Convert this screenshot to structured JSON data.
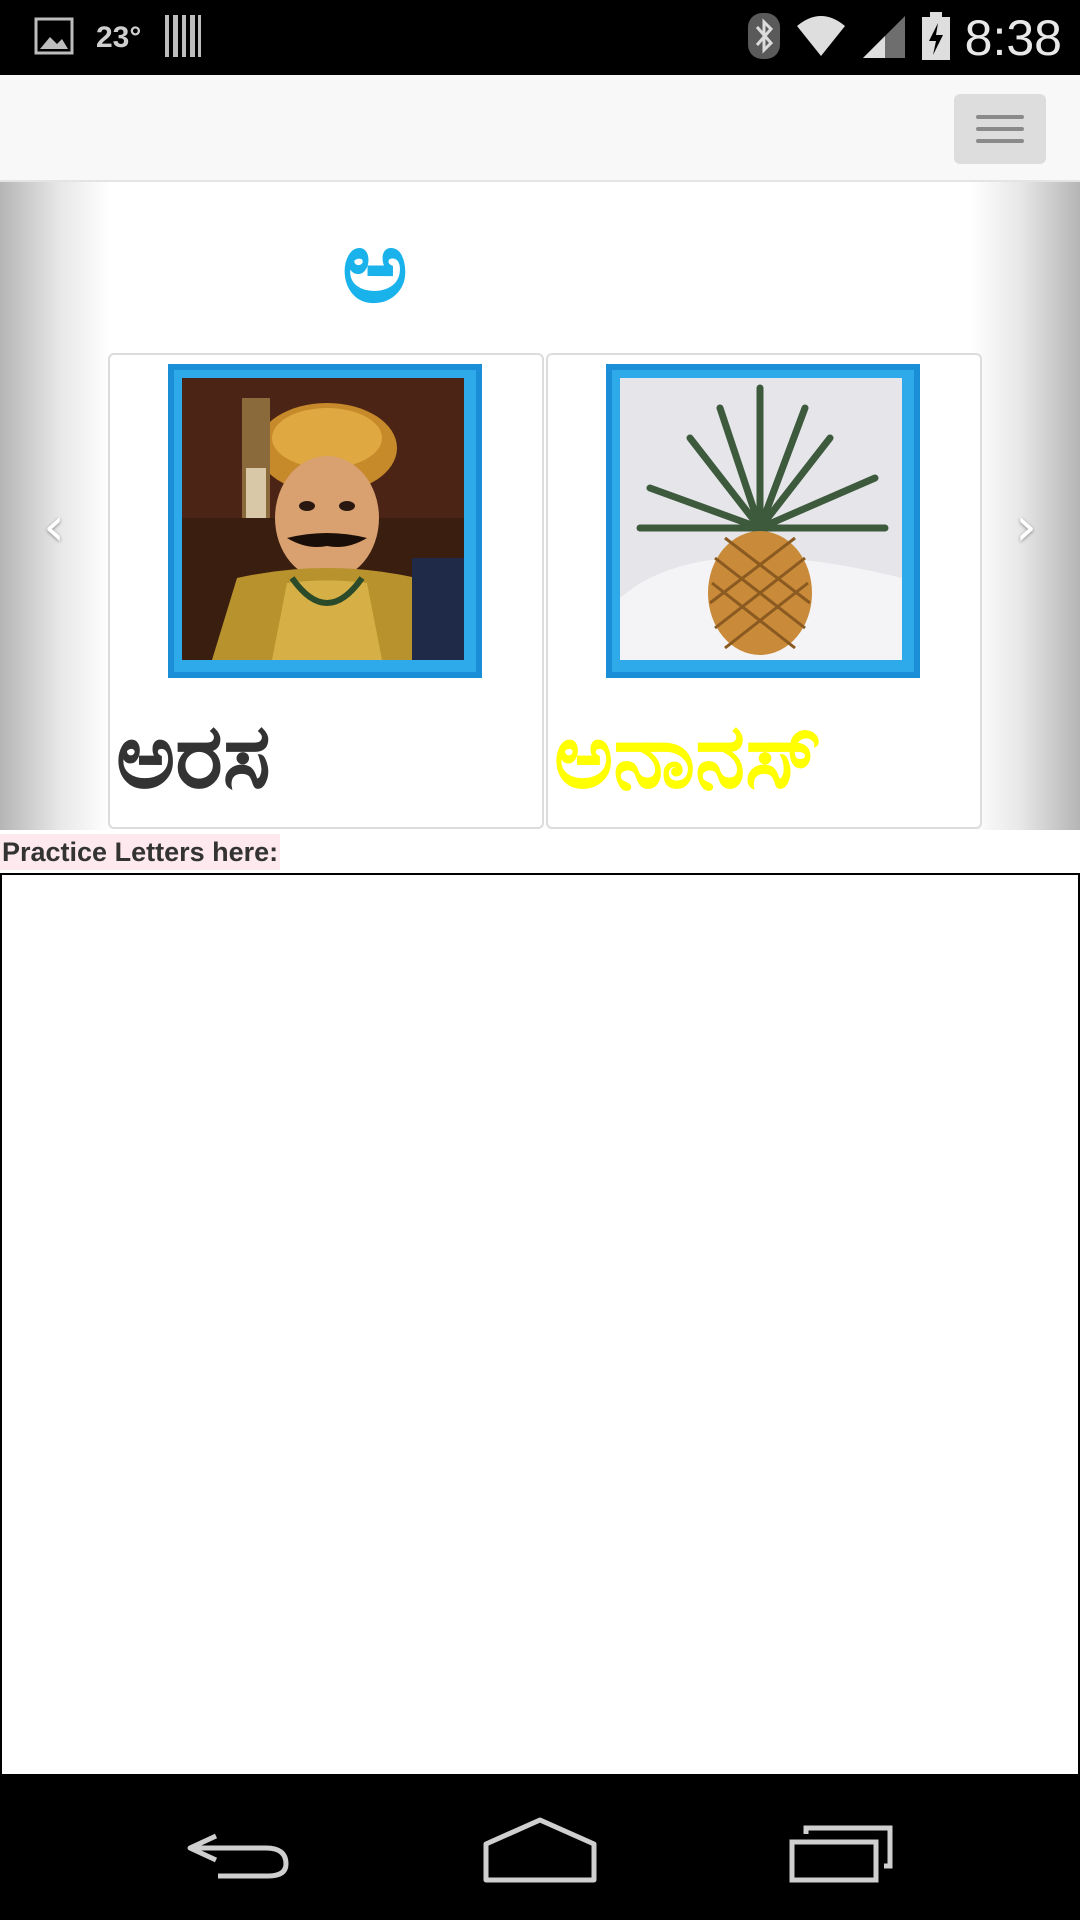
{
  "status_bar": {
    "temperature": "23°",
    "time": "8:38",
    "icons": [
      "image-icon",
      "barcode-icon",
      "bluetooth-icon",
      "wifi-icon",
      "signal-icon",
      "battery-charging-icon"
    ]
  },
  "header": {
    "menu_icon": "hamburger-menu-icon"
  },
  "carousel": {
    "letter": "ಅ",
    "prev_icon": "chevron-left-icon",
    "next_icon": "chevron-right-icon",
    "cards": [
      {
        "word": "ಅರಸ",
        "image": "king-portrait",
        "word_color": "#333333"
      },
      {
        "word": "ಅನಾನಸ್",
        "image": "pineapple",
        "word_color": "#ffff00"
      }
    ]
  },
  "practice": {
    "label": "Practice Letters here:"
  },
  "nav_bar": {
    "icons": [
      "back-icon",
      "home-icon",
      "recents-icon"
    ]
  },
  "colors": {
    "letter": "#1ab2ea",
    "image_frame": "#1a8fd8"
  }
}
